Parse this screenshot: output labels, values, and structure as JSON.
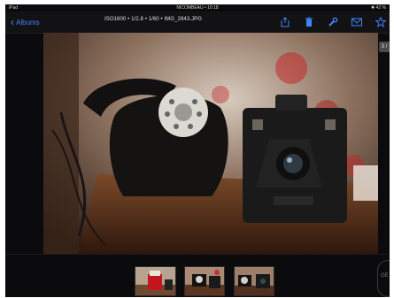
{
  "status_bar": {
    "device": "iPad",
    "wifi": "wifi-icon",
    "carrier_time": "NICOMBEAU • 10:18",
    "battery": "✹ 42 %"
  },
  "nav": {
    "back_label": "Albums",
    "title": "ISO1600 • 1/2.8 • 1/60 • IMG_2843.JPG",
    "icons": [
      "share-icon",
      "trash-icon",
      "edit-wrench-icon",
      "mail-icon",
      "star-icon"
    ]
  },
  "viewer": {
    "counter": "3 /",
    "photo_subject": "vintage-telephone-and-box-camera"
  },
  "thumbnails": [
    {
      "name": "thumbnail-1"
    },
    {
      "name": "thumbnail-2"
    },
    {
      "name": "thumbnail-3"
    }
  ],
  "side_control": {
    "label": "GE"
  },
  "colors": {
    "accent": "#3d86ff",
    "background": "#0b0b0d"
  }
}
